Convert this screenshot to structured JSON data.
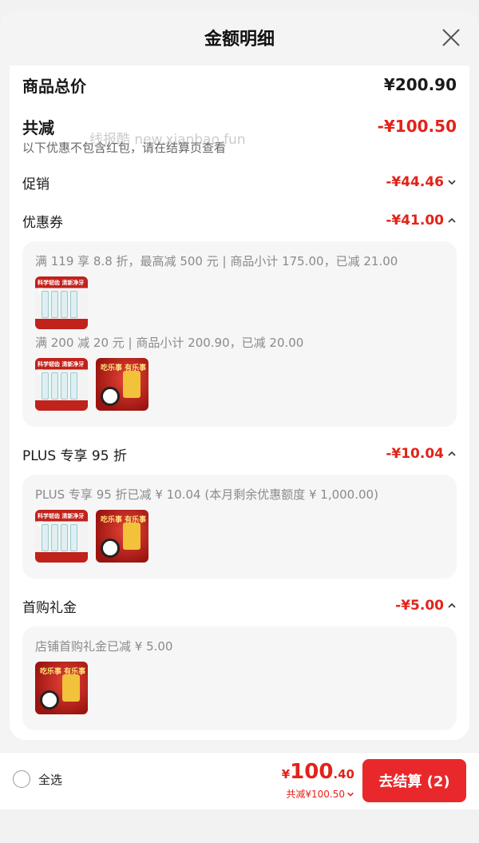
{
  "modal": {
    "title": "金额明细",
    "total_label": "商品总价",
    "total_value": "¥200.90",
    "reduce_label": "共减",
    "reduce_value": "-¥100.50",
    "note": "以下优惠不包含红包，请在结算页查看",
    "watermark": "线报酷 new.xianbao.fun"
  },
  "sections": {
    "promo": {
      "label": "促销",
      "value": "-¥44.46"
    },
    "coupon": {
      "label": "优惠券",
      "value": "-¥41.00",
      "line1": "满 119 享 8.8 折，最高减 500 元 | 商品小计 175.00，已减 21.00",
      "line2": "满 200 减 20 元 | 商品小计 200.90，已减 20.00"
    },
    "plus": {
      "label": "PLUS 专享 95 折",
      "value": "-¥10.04",
      "line1": "PLUS 专享 95 折已减 ¥ 10.04 (本月剩余优惠额度 ¥ 1,000.00)"
    },
    "firstbuy": {
      "label": "首购礼金",
      "value": "-¥5.00",
      "line1": "店铺首购礼金已减 ¥ 5.00"
    }
  },
  "thumbs": {
    "tooth_text": "科学韧齿 清新净牙石",
    "snack_text": "吃乐事 有乐事"
  },
  "footer": {
    "select_all": "全选",
    "price_yen": "¥",
    "price_int": "100",
    "price_dec": ".40",
    "price_sub": "共减¥100.50",
    "checkout": "去结算 (2)"
  },
  "colors": {
    "accent": "#e2231a",
    "button": "#e8282b"
  }
}
